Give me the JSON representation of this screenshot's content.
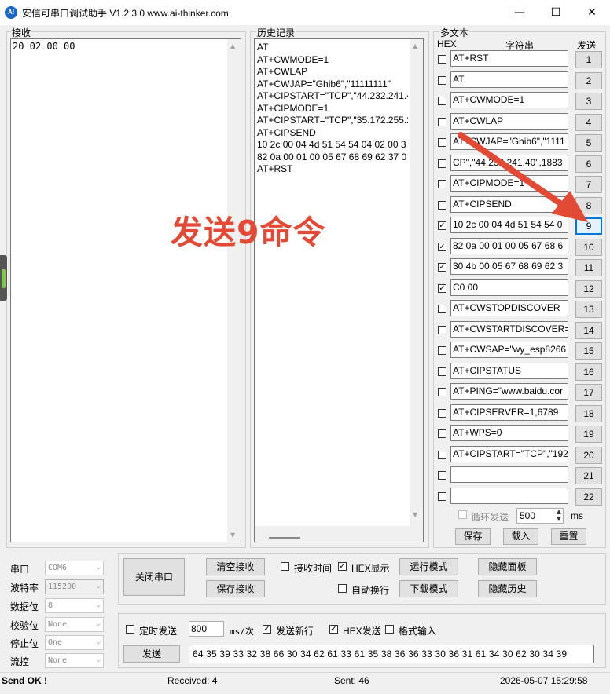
{
  "window": {
    "title": "安信可串口调试助手 V1.2.3.0    www.ai-thinker.com",
    "app_icon_text": "AI",
    "min_glyph": "—",
    "max_glyph": "☐",
    "close_glyph": "✕"
  },
  "receive": {
    "group_label": "接收",
    "content": "20 02 00 00"
  },
  "history": {
    "group_label": "历史记录",
    "lines": [
      "AT",
      "AT+CWMODE=1",
      "AT+CWLAP",
      "AT+CWJAP=\"Ghib6\",\"11111111\"",
      "AT+CIPSTART=\"TCP\",\"44.232.241.4",
      "AT+CIPMODE=1",
      "AT+CIPSTART=\"TCP\",\"35.172.255.2",
      "AT+CIPSEND",
      "10 2c 00 04 4d 51 54 54 04 02 00 3",
      "82 0a 00 01 00 05 67 68 69 62 37 0",
      "AT+RST"
    ]
  },
  "multitext": {
    "group_label": "多文本",
    "col_hex": "HEX",
    "col_string": "字符串",
    "col_send": "发送",
    "rows": [
      {
        "checked": false,
        "text": "AT+RST",
        "btn": "1"
      },
      {
        "checked": false,
        "text": "AT",
        "btn": "2"
      },
      {
        "checked": false,
        "text": "AT+CWMODE=1",
        "btn": "3"
      },
      {
        "checked": false,
        "text": "AT+CWLAP",
        "btn": "4"
      },
      {
        "checked": false,
        "text": "AT+CWJAP=\"Ghib6\",\"1111",
        "btn": "5"
      },
      {
        "checked": false,
        "text": "CP\",\"44.232.241.40\",1883",
        "btn": "6"
      },
      {
        "checked": false,
        "text": "AT+CIPMODE=1",
        "btn": "7"
      },
      {
        "checked": false,
        "text": "AT+CIPSEND",
        "btn": "8"
      },
      {
        "checked": true,
        "text": "10 2c 00 04 4d 51 54 54 0",
        "btn": "9"
      },
      {
        "checked": true,
        "text": "82 0a 00 01 00 05 67 68 6",
        "btn": "10"
      },
      {
        "checked": true,
        "text": "30 4b 00 05 67 68 69 62 3",
        "btn": "11"
      },
      {
        "checked": true,
        "text": "C0 00",
        "btn": "12"
      },
      {
        "checked": false,
        "text": "AT+CWSTOPDISCOVER",
        "btn": "13"
      },
      {
        "checked": false,
        "text": "AT+CWSTARTDISCOVER=",
        "btn": "14"
      },
      {
        "checked": false,
        "text": "AT+CWSAP=\"wy_esp8266",
        "btn": "15"
      },
      {
        "checked": false,
        "text": "AT+CIPSTATUS",
        "btn": "16"
      },
      {
        "checked": false,
        "text": "AT+PING=\"www.baidu.cor",
        "btn": "17"
      },
      {
        "checked": false,
        "text": "AT+CIPSERVER=1,6789",
        "btn": "18"
      },
      {
        "checked": false,
        "text": "AT+WPS=0",
        "btn": "19"
      },
      {
        "checked": false,
        "text": "AT+CIPSTART=\"TCP\",\"192",
        "btn": "20"
      },
      {
        "checked": false,
        "text": "",
        "btn": "21"
      },
      {
        "checked": false,
        "text": "",
        "btn": "22"
      }
    ],
    "loop_send_label": "循环发送",
    "loop_interval": "500",
    "loop_unit": "ms",
    "save_btn": "保存",
    "load_btn": "载入",
    "reset_btn": "重置"
  },
  "serial": {
    "port_label": "串口",
    "port_value": "COM6",
    "baud_label": "波特率",
    "baud_value": "115200",
    "databits_label": "数据位",
    "databits_value": "8",
    "parity_label": "校验位",
    "parity_value": "None",
    "stopbits_label": "停止位",
    "stopbits_value": "One",
    "flow_label": "流控",
    "flow_value": "None"
  },
  "controls": {
    "close_port_btn": "关闭串口",
    "clear_recv_btn": "清空接收",
    "save_recv_btn": "保存接收",
    "recv_time_label": "接收时间",
    "hex_display_label": "HEX显示",
    "auto_wrap_label": "自动换行",
    "run_mode_btn": "运行模式",
    "download_mode_btn": "下载模式",
    "hide_panel_btn": "隐藏面板",
    "hide_history_btn": "隐藏历史"
  },
  "send": {
    "timed_send_label": "定时发送",
    "interval": "800",
    "unit": "ms/次",
    "newline_label": "发送新行",
    "hex_send_label": "HEX发送",
    "format_input_label": "格式输入",
    "send_btn": "发送",
    "content": "64 35 39 33 32 38 66 30 34 62 61 33 61 35 38 36 36 33 30 36 31 61 34 30 62 30 34 39"
  },
  "statusbar": {
    "message": "Send OK !",
    "received": "Received: 4",
    "sent": "Sent: 46",
    "datetime": "2026-05-07 15:29:58"
  },
  "annotation": {
    "text": "发送9命令",
    "color": "#e24a36"
  }
}
